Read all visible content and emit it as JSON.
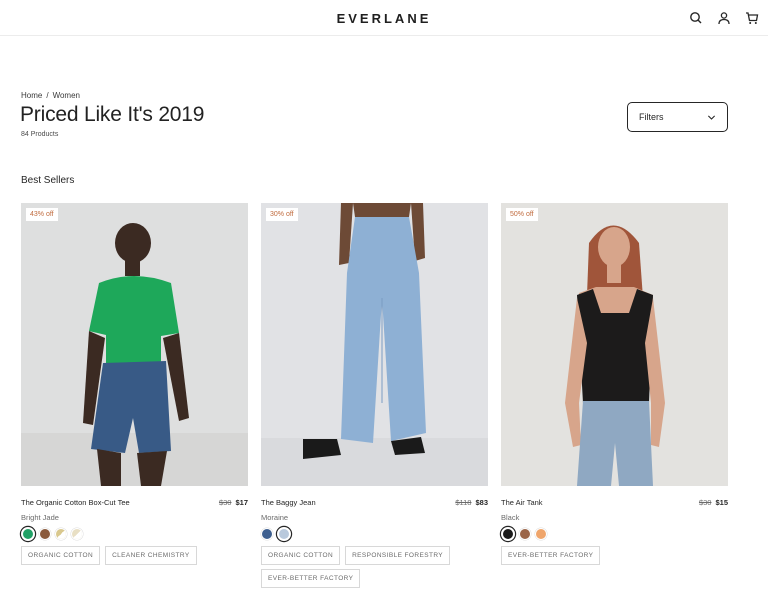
{
  "header": {
    "logo": "EVERLANE"
  },
  "breadcrumb": {
    "home": "Home",
    "sep": "/",
    "current": "Women"
  },
  "page": {
    "title": "Priced Like It's 2019",
    "count": "84 Products",
    "filters_label": "Filters"
  },
  "section": {
    "title": "Best Sellers"
  },
  "colors": {
    "accent": "#c06b3e",
    "text": "#262626",
    "muted": "#6b6b6b"
  },
  "products": [
    {
      "badge": "43% off",
      "name": "The Organic Cotton Box-Cut Tee",
      "orig_price": "$30",
      "sale_price": "$17",
      "color": "Bright Jade",
      "swatches": [
        "#21a166",
        "#8a5a3c",
        "#d9c88e",
        "#e8dfc4"
      ],
      "tags": [
        "ORGANIC COTTON",
        "CLEANER CHEMISTRY"
      ]
    },
    {
      "badge": "30% off",
      "name": "The Baggy Jean",
      "orig_price": "$118",
      "sale_price": "$83",
      "color": "Moraine",
      "swatches": [
        "#3d5f8f",
        "#b9c9dc"
      ],
      "tags": [
        "ORGANIC COTTON",
        "RESPONSIBLE FORESTRY",
        "EVER-BETTER FACTORY"
      ]
    },
    {
      "badge": "50% off",
      "name": "The Air Tank",
      "orig_price": "$30",
      "sale_price": "$15",
      "color": "Black",
      "swatches": [
        "#1a1a1a",
        "#9a6447",
        "#efa56b"
      ],
      "tags": [
        "EVER-BETTER FACTORY"
      ]
    }
  ]
}
